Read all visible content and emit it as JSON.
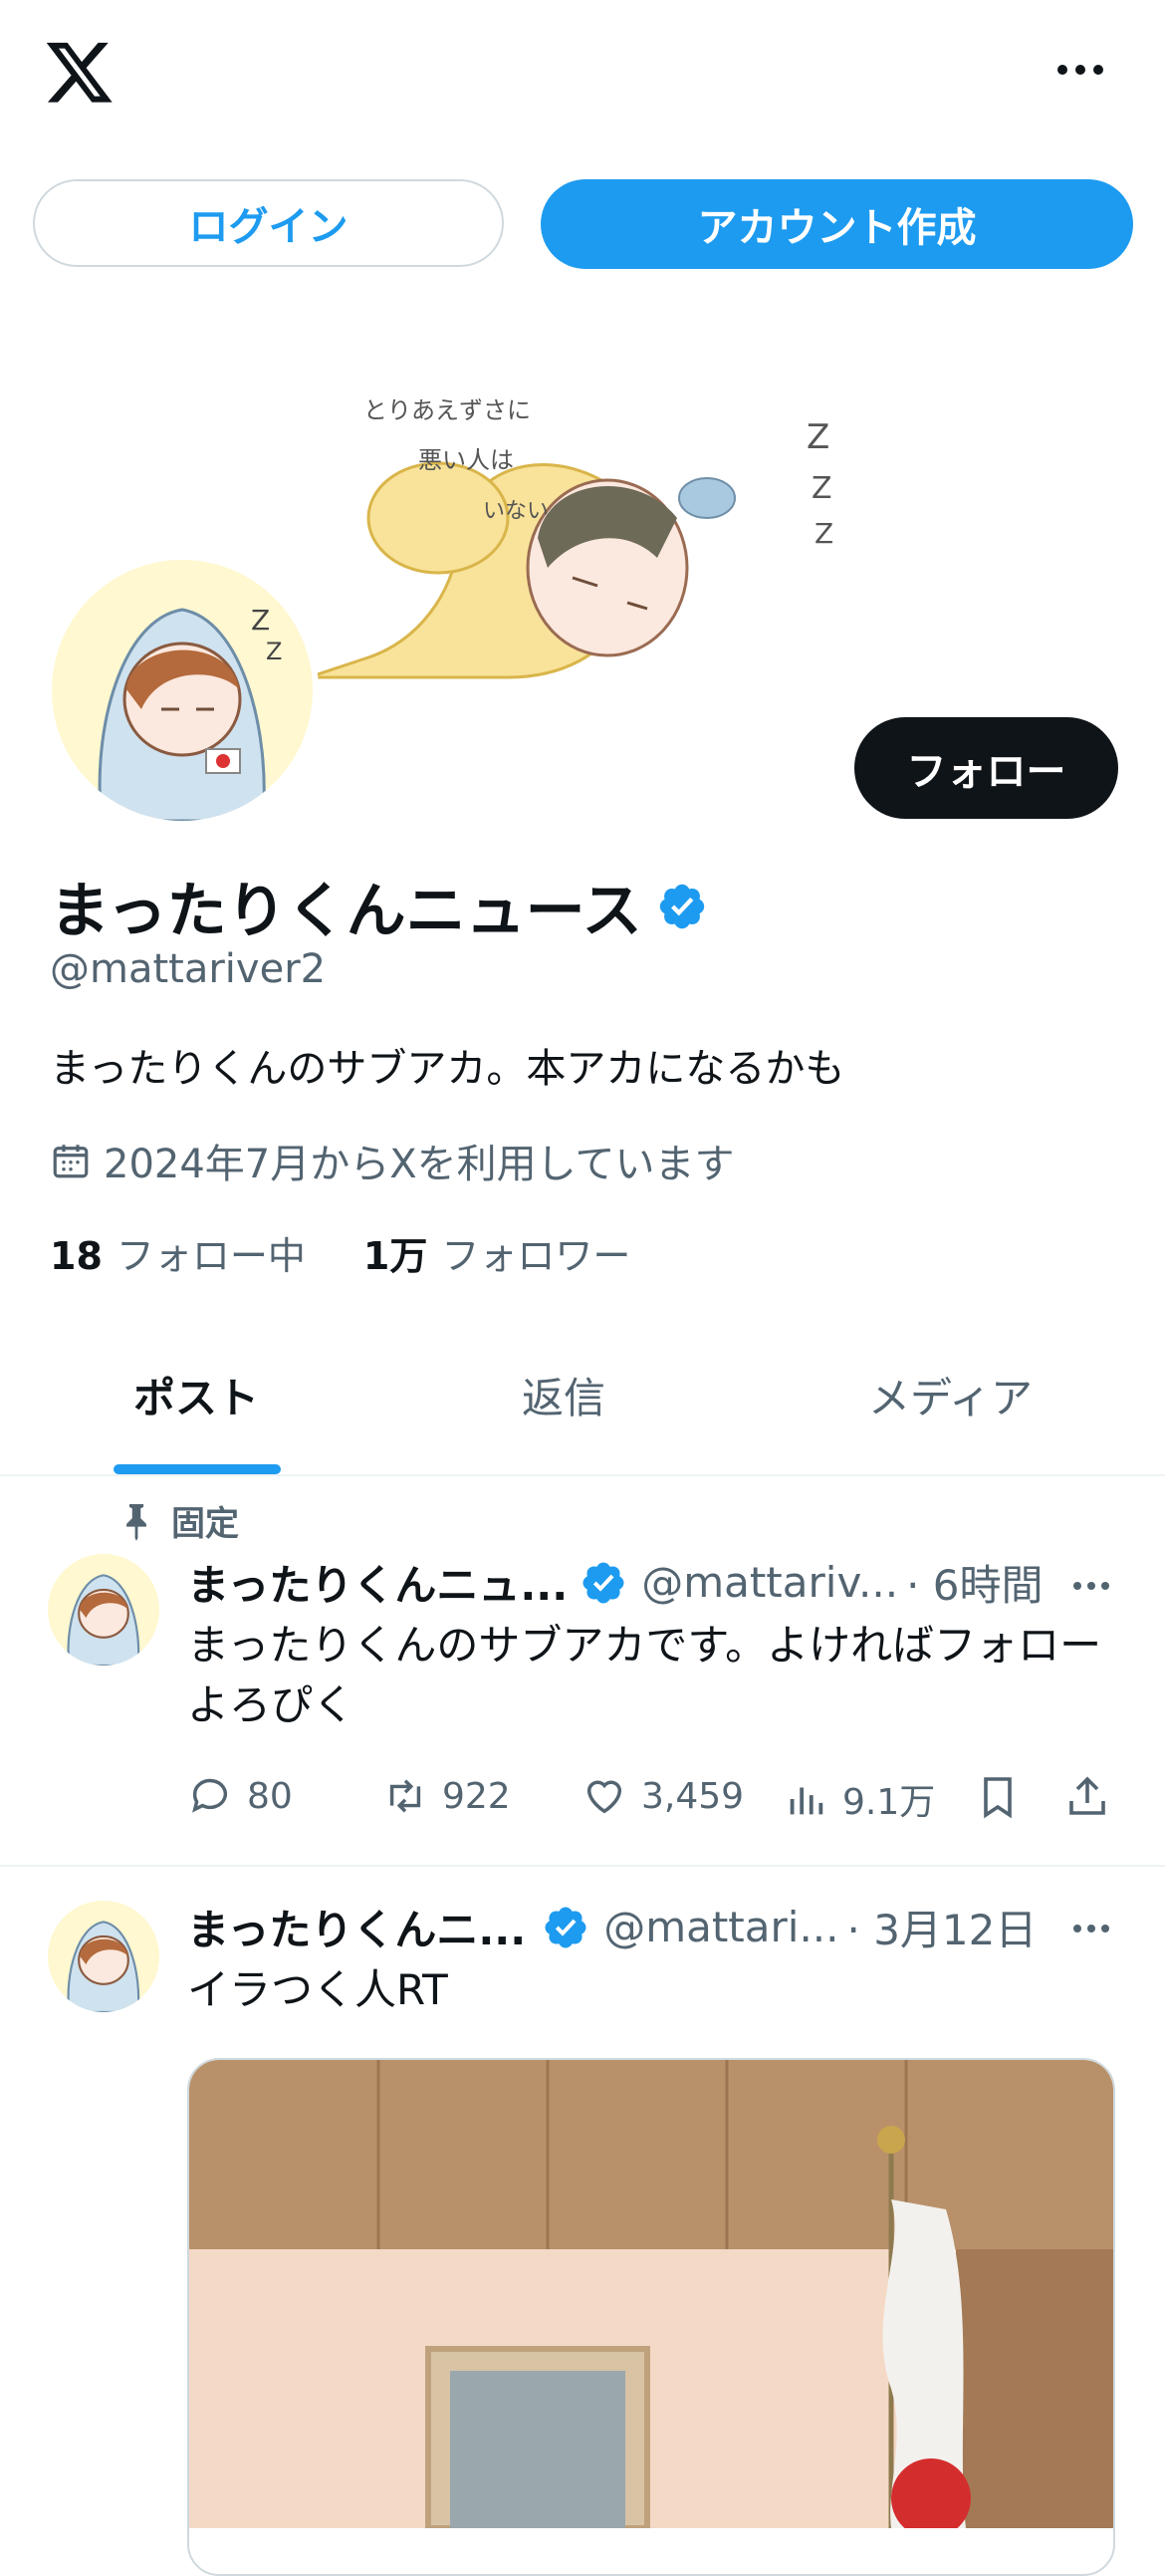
{
  "topbar": {
    "logo_icon": "x-logo-icon",
    "more_icon": "more-icon"
  },
  "auth": {
    "login_label": "ログイン",
    "signup_label": "アカウント作成"
  },
  "banner": {
    "text_lines": [
      "とりあえずさに",
      "悪い人は",
      "いない"
    ]
  },
  "profile": {
    "name": "まったりくんニュース",
    "handle": "@mattariver2",
    "bio": "まったりくんのサブアカ。本アカになるかも",
    "joined": "2024年7月からXを利用しています",
    "following_count": "18",
    "following_label": "フォロー中",
    "followers_count": "1万",
    "followers_label": "フォロワー",
    "follow_label": "フォロー"
  },
  "tabs": [
    {
      "label": "ポスト"
    },
    {
      "label": "返信"
    },
    {
      "label": "メディア"
    }
  ],
  "pinned_label": "固定",
  "posts": [
    {
      "name": "まったりくんニュ...",
      "handle": "@mattariv...",
      "time": "· 6時間",
      "text_lines": [
        "まったりくんのサブアカです。よければフォロー",
        "よろぴく"
      ],
      "replies": "80",
      "reposts": "922",
      "likes": "3,459",
      "views": "9.1万"
    },
    {
      "name": "まったりくんニ...",
      "handle": "@mattari...",
      "time": "· 3月12日",
      "text_lines": [
        "イラつく人RT"
      ]
    }
  ],
  "colors": {
    "accent": "#1d9bf0",
    "text": "#0f1419",
    "secondary": "#536471",
    "border": "#cfd9de"
  }
}
